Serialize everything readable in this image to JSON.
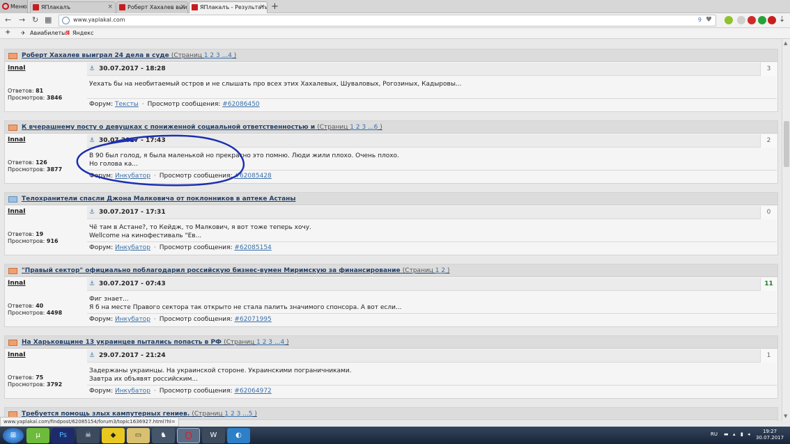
{
  "browser": {
    "menu_label": "Меню",
    "tabs": [
      {
        "label": "ЯПлакалъ"
      },
      {
        "label": "Роберт Хахалев выиграл"
      },
      {
        "label": "ЯПлакалъ - Результаты п"
      }
    ],
    "url": "www.yaplakal.com",
    "url_badge": "9",
    "bookmarks": [
      {
        "label": "Авиабилеты"
      },
      {
        "label": "Яндекс"
      }
    ]
  },
  "labels": {
    "replies": "Ответов:",
    "views": "Просмотров:",
    "forum": "Форум:",
    "view_message": "Просмотр сообщения:"
  },
  "posts": [
    {
      "title": "Роберт Хахалев выиграл 24 дела в суде",
      "pages_prefix": "(Страниц ",
      "pages_links": "1 2 3 ...4",
      "pages_suffix": " )",
      "author": "InnaI",
      "replies": "81",
      "views": "3846",
      "date": "30.07.2017 - 18:28",
      "count": "3",
      "text": "Уехать бы на необитаемый остров и не слышать про всех этих Хахалевых, Шуваловых, Рогозиных, Кадыровы...",
      "forum": "Тексты",
      "msg": "#62086450"
    },
    {
      "title": "К вчерашнему посту о девушках с пониженной социальной ответственностью и",
      "pages_prefix": "(Страниц ",
      "pages_links": "1 2 3 ...6",
      "pages_suffix": " )",
      "author": "InnaI",
      "replies": "126",
      "views": "3877",
      "date": "30.07.2017 - 17:43",
      "count": "2",
      "text": "В 90 был голод, я была маленькой но прекрасно это помню. Люди жили плохо. Очень плохо.\nНо голова ка...",
      "forum": "Инкубатор",
      "msg": "#62085428"
    },
    {
      "title": "Телохранители спасли Джона Малковича от поклонников в аптеке Астаны",
      "pages_prefix": "",
      "pages_links": "",
      "pages_suffix": "",
      "author": "InnaI",
      "replies": "19",
      "views": "916",
      "date": "30.07.2017 - 17:31",
      "count": "0",
      "text": "Чё там в Астане?, то Кейдж, то Малкович, я вот тоже теперь хочу.\nWellcome на кинофестиваль \"Ев...",
      "forum": "Инкубатор",
      "msg": "#62085154"
    },
    {
      "title": "\"Правый сектор\" официально поблагодарил российскую бизнес-вумен Миримскую за финансирование",
      "pages_prefix": "(Страниц ",
      "pages_links": "1 2",
      "pages_suffix": " )",
      "author": "InnaI",
      "replies": "40",
      "views": "4498",
      "date": "30.07.2017 - 07:43",
      "count": "11",
      "text": "Фиг знает...\nЯ б на месте Правого сектора так открыто не стала палить значимого спонсора. А вот если...",
      "forum": "Инкубатор",
      "msg": "#62071995"
    },
    {
      "title": "На Харьковщине 13 украинцев пытались попасть в РФ",
      "pages_prefix": "(Страниц ",
      "pages_links": "1 2 3 ...4",
      "pages_suffix": " )",
      "author": "InnaI",
      "replies": "75",
      "views": "3792",
      "date": "29.07.2017 - 21:24",
      "count": "1",
      "text": "Задержаны украинцы. На украинской стороне. Украинскими пограничниками.\nЗавтра их объявят российским...",
      "forum": "Инкубатор",
      "msg": "#62064972"
    },
    {
      "title": "Требуется помощь злых кампутерных гениев.",
      "pages_prefix": "(Страниц ",
      "pages_links": "1 2 3 ...5",
      "pages_suffix": " )"
    }
  ],
  "status_url": "www.yaplakal.com/findpost/62085154/forum3/topic1636927.html?hl=",
  "taskbar": {
    "lang": "RU",
    "time": "19:27",
    "date": "30.07.2017"
  },
  "colors": {
    "link": "#233f66",
    "annotation": "#1c2fb0"
  }
}
